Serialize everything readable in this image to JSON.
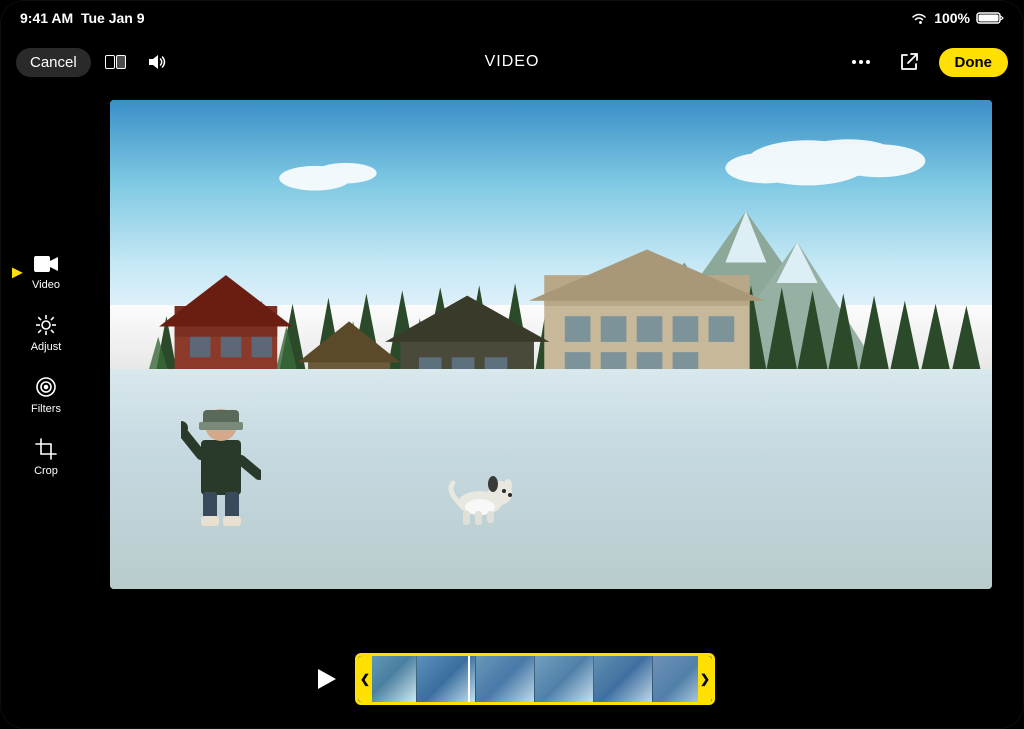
{
  "statusBar": {
    "time": "9:41 AM",
    "date": "Tue Jan 9",
    "battery": "100%",
    "wifiStrength": 3
  },
  "toolbar": {
    "cancelLabel": "Cancel",
    "title": "VIDEO",
    "doneLabel": "Done"
  },
  "sidePanel": {
    "items": [
      {
        "id": "video",
        "label": "Video",
        "active": true
      },
      {
        "id": "adjust",
        "label": "Adjust",
        "active": false
      },
      {
        "id": "filters",
        "label": "Filters",
        "active": false
      },
      {
        "id": "crop",
        "label": "Crop",
        "active": false
      }
    ]
  },
  "timeline": {
    "playButtonLabel": "Play",
    "frameCount": 6
  },
  "icons": {
    "video": "📹",
    "adjust": "⚙",
    "filters": "◎",
    "crop": "⊞",
    "moreOptions": "•••",
    "externalLink": "↗",
    "volume": "🔊",
    "wifi": "wifi",
    "battery": "battery"
  }
}
